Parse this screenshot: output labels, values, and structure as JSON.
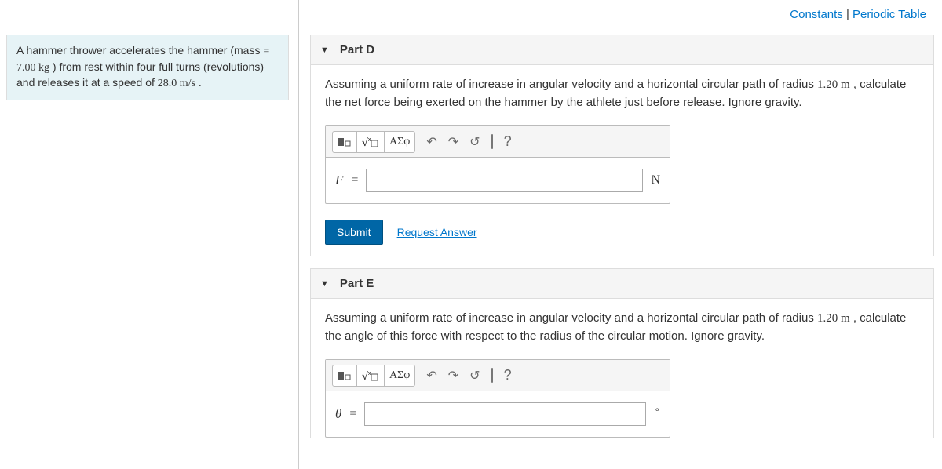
{
  "top_links": {
    "constants": "Constants",
    "sep": " | ",
    "periodic": "Periodic Table"
  },
  "problem": {
    "text_1": "A hammer thrower accelerates the hammer (mass ",
    "mass": "= 7.00 kg",
    "text_2": " ) from rest within four full turns (revolutions) and releases it at a speed of ",
    "speed": "28.0 m/s",
    "text_3": " ."
  },
  "parts": {
    "d": {
      "label": "Part D",
      "prompt_1": "Assuming a uniform rate of increase in angular velocity and a horizontal circular path of radius ",
      "radius": "1.20 m",
      "prompt_2": " , calculate the net force being exerted on the hammer by the athlete just before release. Ignore gravity.",
      "var": "F",
      "unit": "N",
      "submit": "Submit",
      "request": "Request Answer"
    },
    "e": {
      "label": "Part E",
      "prompt_1": "Assuming a uniform rate of increase in angular velocity and a horizontal circular path of radius ",
      "radius": "1.20 m",
      "prompt_2": " , calculate the angle of this force with respect to the radius of the circular motion. Ignore gravity.",
      "var": "θ",
      "unit": "∘"
    }
  },
  "toolbar": {
    "greek": "ΑΣφ",
    "help": "?"
  }
}
